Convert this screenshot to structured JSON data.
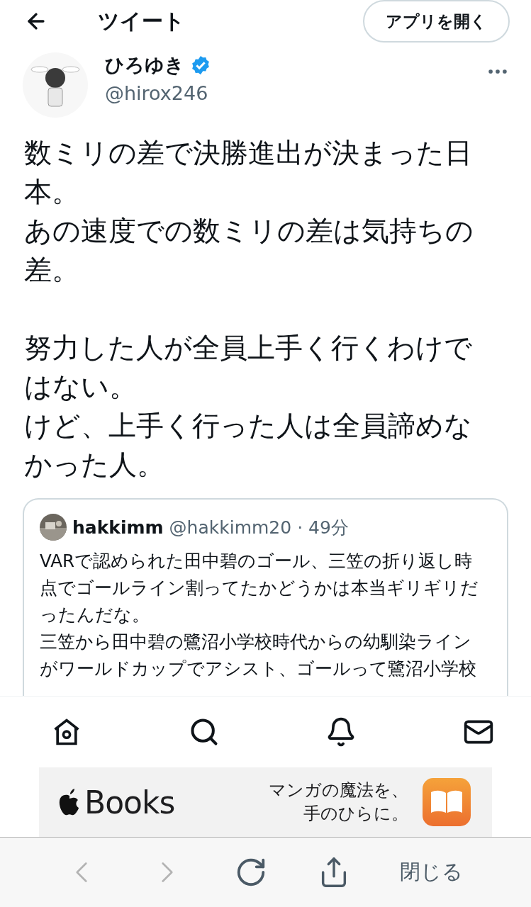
{
  "header": {
    "title": "ツイート",
    "open_app": "アプリを開く"
  },
  "author": {
    "name": "ひろゆき",
    "verified": true,
    "handle": "@hirox246"
  },
  "tweet_paragraphs": [
    [
      "数ミリの差で決勝進出が決まった日",
      "本。",
      "あの速度での数ミリの差は気持ちの",
      "差。"
    ],
    [
      "努力した人が全員上手く行くわけで",
      "はない。",
      "けど、上手く行った人は全員諦めな",
      "かった人。"
    ]
  ],
  "quote": {
    "name": "hakkimm",
    "handle": "@hakkimm20",
    "time": "· 49分",
    "lines": [
      "VARで認められた田中碧のゴール、三笠の折り返し時",
      "点でゴールライン割ってたかどうかは本当ギリギリだ",
      "ったんだな。",
      "三笠から田中碧の鷺沼小学校時代からの幼馴染ライン",
      "がワールドカップでアシスト、ゴールって鷺沼小学校"
    ]
  },
  "tab_bar": [
    {
      "kind": "home"
    },
    {
      "kind": "search"
    },
    {
      "kind": "bell"
    },
    {
      "kind": "mail"
    }
  ],
  "ad": {
    "brand": "Books",
    "tagline": [
      "マンガの魔法を、",
      "手のひらに。"
    ]
  },
  "browser_bar": {
    "nav": [
      {
        "kind": "back",
        "disabled": true
      },
      {
        "kind": "forward",
        "disabled": true
      },
      {
        "kind": "reload",
        "disabled": false
      },
      {
        "kind": "share",
        "disabled": false
      }
    ],
    "close": "閉じる"
  }
}
